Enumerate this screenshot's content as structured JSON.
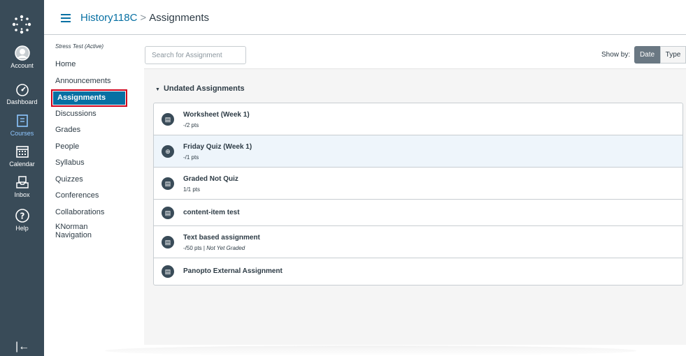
{
  "global_nav": {
    "items": [
      {
        "label": "Account",
        "icon": "account-icon"
      },
      {
        "label": "Dashboard",
        "icon": "dashboard-icon"
      },
      {
        "label": "Courses",
        "icon": "courses-icon"
      },
      {
        "label": "Calendar",
        "icon": "calendar-icon"
      },
      {
        "label": "Inbox",
        "icon": "inbox-icon"
      },
      {
        "label": "Help",
        "icon": "help-icon"
      }
    ],
    "collapse_label": "|←"
  },
  "breadcrumb": {
    "course": "History118C",
    "separator": ">",
    "page": "Assignments"
  },
  "course_nav": {
    "status": "Stress Test (Active)",
    "items": [
      {
        "label": "Home"
      },
      {
        "label": "Announcements"
      },
      {
        "label": "Assignments"
      },
      {
        "label": "Discussions"
      },
      {
        "label": "Grades"
      },
      {
        "label": "People"
      },
      {
        "label": "Syllabus"
      },
      {
        "label": "Quizzes"
      },
      {
        "label": "Conferences"
      },
      {
        "label": "Collaborations"
      },
      {
        "label": "KNorman Navigation"
      }
    ]
  },
  "toolbar": {
    "search_placeholder": "Search for Assignment",
    "show_by": "Show by:",
    "date_label": "Date",
    "type_label": "Type"
  },
  "group": {
    "title": "Undated Assignments"
  },
  "assignments": [
    {
      "title": "Worksheet (Week 1)",
      "pts": "-/2 pts"
    },
    {
      "title": "Friday Quiz (Week 1)",
      "pts": "-/1 pts"
    },
    {
      "title": "Graded Not Quiz",
      "pts": "1/1 pts"
    },
    {
      "title": "content-item test"
    },
    {
      "title": "Text based assignment",
      "pts": "-/50 pts",
      "pts_sep": "|",
      "pts_note": "Not Yet Graded"
    },
    {
      "title": "Panopto External Assignment"
    }
  ]
}
